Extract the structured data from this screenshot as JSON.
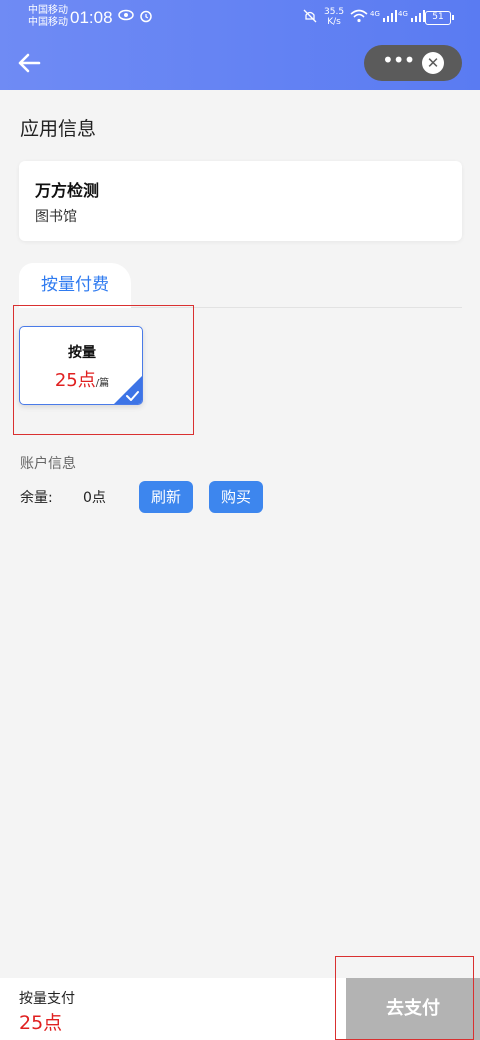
{
  "status_bar": {
    "carrier1": "中国移动",
    "carrier2": "中国移动",
    "time": "01:08",
    "speed_value": "35.5",
    "speed_unit": "K/s",
    "net1": "4G",
    "net2": "4G",
    "battery": "51"
  },
  "nav": {
    "back_icon": "arrow-left-icon",
    "more_icon": "more-dots-icon",
    "more_glyph": "•••",
    "close_icon": "close-circle-icon",
    "close_glyph": "✕"
  },
  "section_title": "应用信息",
  "app": {
    "name": "万方检测",
    "subtitle": "图书馆"
  },
  "tabs": [
    {
      "label": "按量付费",
      "active": true
    }
  ],
  "plan": {
    "name": "按量",
    "price": "25点",
    "unit": "/篇",
    "selected": true
  },
  "account": {
    "title": "账户信息",
    "balance_label": "余量:",
    "balance_value": "0点",
    "refresh_label": "刷新",
    "buy_label": "购买"
  },
  "footer": {
    "label": "按量支付",
    "price": "25点",
    "pay_label": "去支付"
  },
  "colors": {
    "accent": "#3d86ee",
    "price_red": "#e02020",
    "highlight_red": "#d93030",
    "header_gradient_start": "#6f8bf4",
    "header_gradient_end": "#5a7bf2",
    "disabled_button": "#b3b3b3"
  }
}
